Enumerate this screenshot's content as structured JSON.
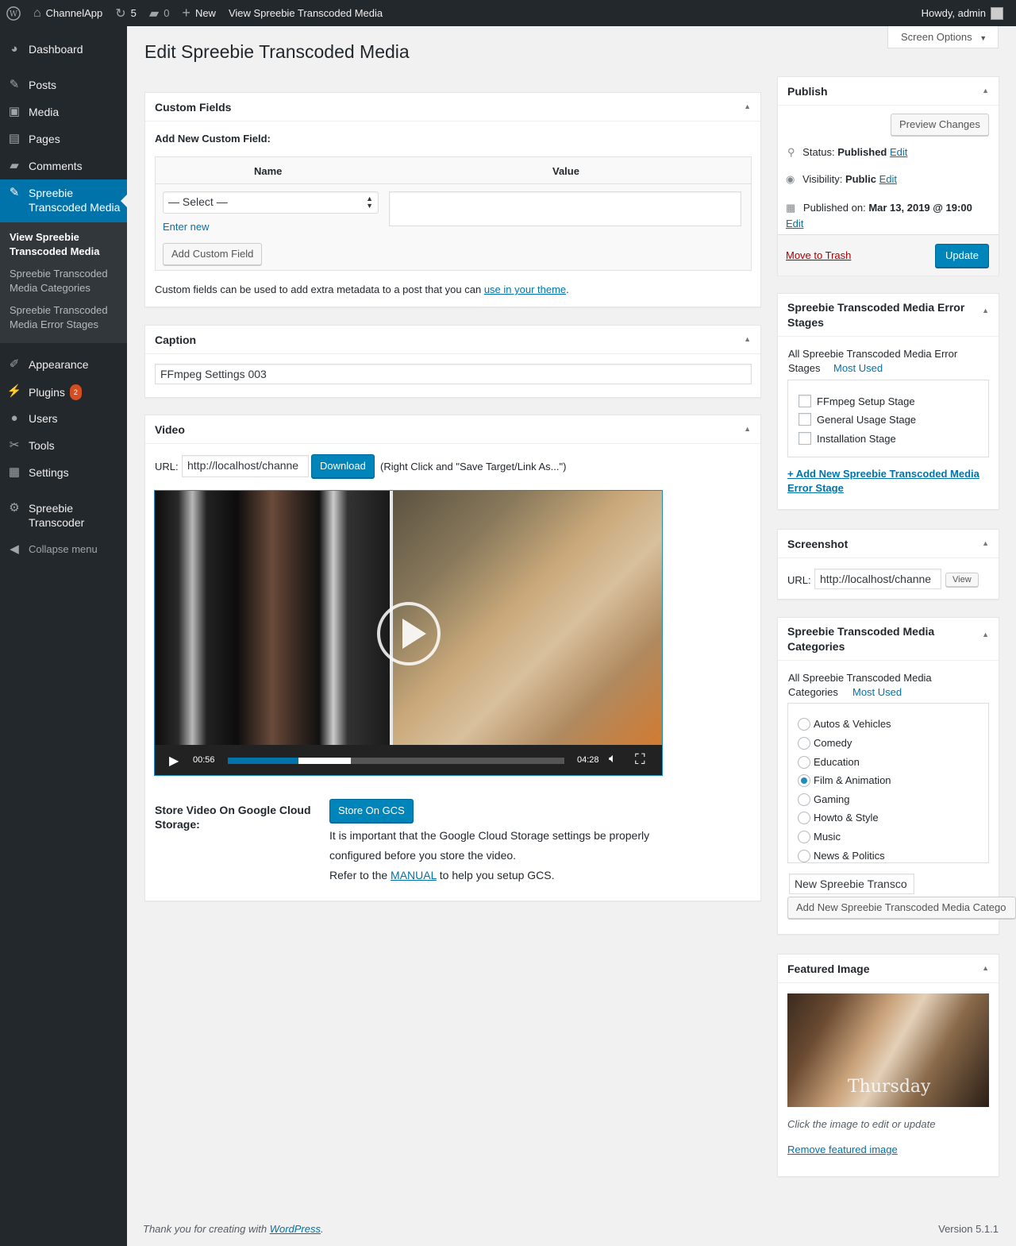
{
  "adminbar": {
    "site_name": "ChannelApp",
    "updates_count": "5",
    "comments_count": "0",
    "new_label": "New",
    "view_label": "View Spreebie Transcoded Media",
    "howdy": "Howdy, admin"
  },
  "sidebar": {
    "dashboard": "Dashboard",
    "posts": "Posts",
    "media": "Media",
    "pages": "Pages",
    "comments": "Comments",
    "active_line1": "Spreebie",
    "active_line2": "Transcoded Media",
    "sub_view_1": "View Spreebie",
    "sub_view_2": "Transcoded Media",
    "sub_cat_1": "Spreebie Transcoded",
    "sub_cat_2": "Media Categories",
    "sub_err_1": "Spreebie Transcoded",
    "sub_err_2": "Media Error Stages",
    "appearance": "Appearance",
    "plugins": "Plugins",
    "plugins_badge": "2",
    "users": "Users",
    "tools": "Tools",
    "settings": "Settings",
    "transcoder_1": "Spreebie",
    "transcoder_2": "Transcoder",
    "collapse": "Collapse menu"
  },
  "page": {
    "title": "Edit Spreebie Transcoded Media",
    "screen_options": "Screen Options"
  },
  "custom_fields": {
    "title": "Custom Fields",
    "add_new_label": "Add New Custom Field:",
    "col_name": "Name",
    "col_value": "Value",
    "select_value": "— Select —",
    "enter_new": "Enter new",
    "add_button": "Add Custom Field",
    "help_text": "Custom fields can be used to add extra metadata to a post that you can",
    "help_link": "use in your theme",
    "help_end": "."
  },
  "caption": {
    "title": "Caption",
    "value": "FFmpeg Settings 003"
  },
  "video": {
    "title": "Video",
    "url_label": "URL:",
    "url_value": "http://localhost/channe",
    "download_button": "Download",
    "download_hint": "(Right Click and \"Save Target/Link As...\")",
    "current_time": "00:56",
    "duration": "04:28",
    "played_fraction": 0.209,
    "buffered_fraction": 0.365,
    "gcs_label_1": "Store Video On Google Cloud",
    "gcs_label_2": "Storage:",
    "gcs_button": "Store On GCS",
    "gcs_note_1": "It is important that the Google Cloud Storage settings be properly",
    "gcs_note_2": "configured before you store the video.",
    "gcs_refer": "Refer to the",
    "gcs_manual": "MANUAL",
    "gcs_refer_end": "to help you setup GCS."
  },
  "publish": {
    "title": "Publish",
    "preview": "Preview Changes",
    "status_label": "Status:",
    "status_value": "Published",
    "visibility_label": "Visibility:",
    "visibility_value": "Public",
    "published_label": "Published on:",
    "published_value": "Mar 13, 2019 @ 19:00",
    "edit": "Edit",
    "trash": "Move to Trash",
    "update": "Update"
  },
  "error_stages": {
    "title_1": "Spreebie Transcoded Media Error",
    "title_2": "Stages",
    "tab_all_1": "All Spreebie Transcoded Media Error",
    "tab_all_2": "Stages",
    "tab_most": "Most Used",
    "items": [
      "FFmpeg Setup Stage",
      "General Usage Stage",
      "Installation Stage"
    ],
    "add_link_1": "+ Add New Spreebie Transcoded Media",
    "add_link_2": "Error Stage"
  },
  "screenshot": {
    "title": "Screenshot",
    "url_label": "URL:",
    "url_value": "http://localhost/channe",
    "view_button": "View"
  },
  "categories": {
    "title_1": "Spreebie Transcoded Media",
    "title_2": "Categories",
    "tab_all_1": "All Spreebie Transcoded Media",
    "tab_all_2": "Categories",
    "tab_most": "Most Used",
    "items": [
      "Autos & Vehicles",
      "Comedy",
      "Education",
      "Film & Animation",
      "Gaming",
      "Howto & Style",
      "Music",
      "News & Politics"
    ],
    "selected": "Film & Animation",
    "new_input": "New Spreebie Transco",
    "add_button": "Add New Spreebie Transcoded Media Catego"
  },
  "featured": {
    "title": "Featured Image",
    "image_caption": "Thursday",
    "hint": "Click the image to edit or update",
    "remove": "Remove featured image"
  },
  "footer": {
    "thanks": "Thank you for creating with",
    "wp_link": "WordPress",
    "period": ".",
    "version": "Version 5.1.1"
  }
}
